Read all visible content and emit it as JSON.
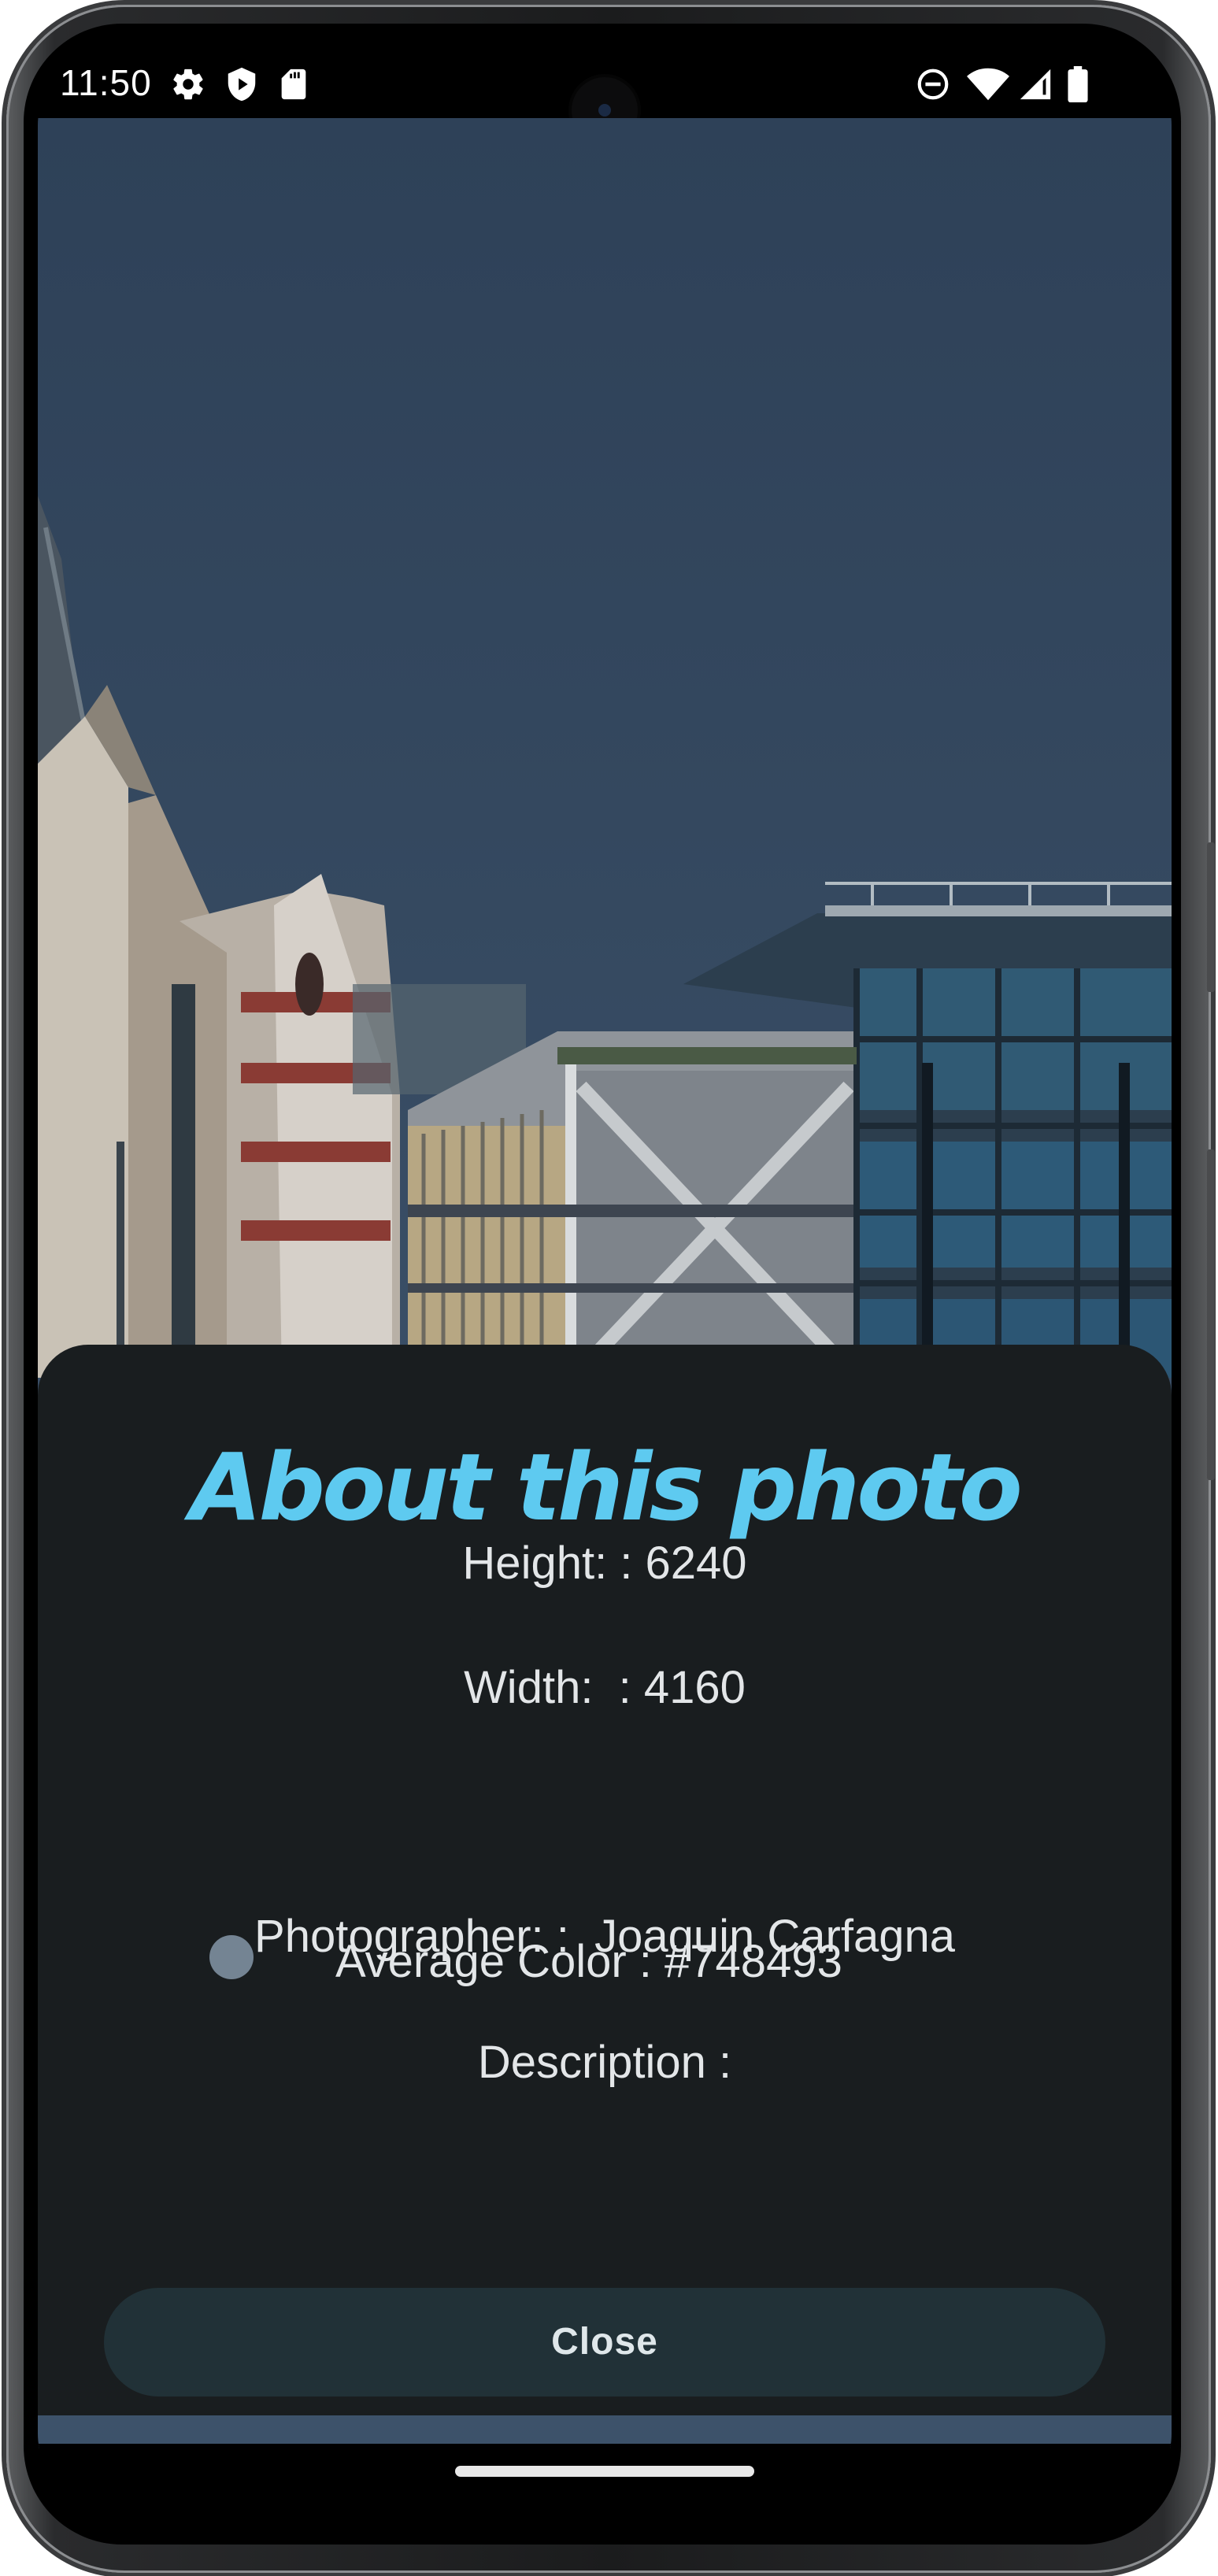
{
  "status_bar": {
    "time": "11:50",
    "left_icons": [
      "gear-icon",
      "play-shield-icon",
      "sd-card-icon"
    ],
    "right_icons": [
      "do-not-disturb-icon",
      "wifi-icon",
      "signal-icon",
      "battery-icon"
    ]
  },
  "sheet": {
    "title": "About this photo",
    "height_line": "Height: : 6240",
    "width_line": "Width:  : 4160",
    "average_color_line": "Average Color : #748493",
    "average_color_hex": "#748493",
    "photographer_line": "Photographer: :  Joaquin Carfagna",
    "description_line": "Description :",
    "close_label": "Close"
  },
  "colors": {
    "accent_title": "#5ecaf0",
    "sheet_background": "#191d1f",
    "button_background": "#213137",
    "sky": "#34485f"
  }
}
